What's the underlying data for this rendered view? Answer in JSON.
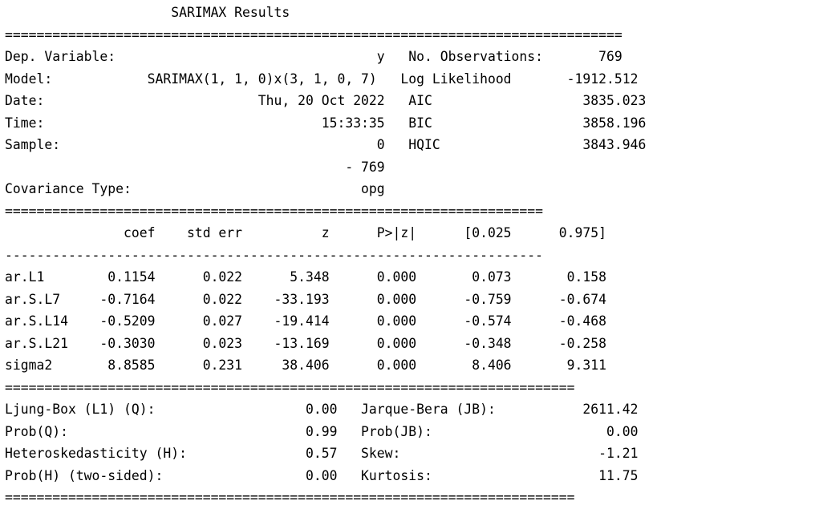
{
  "title": "SARIMAX Results",
  "lines": [
    "                     SARIMAX Results                                          ",
    "==============================================================================",
    "Dep. Variable:                                 y   No. Observations:       769",
    "Model:            SARIMAX(1, 1, 0)x(3, 1, 0, 7)   Log Likelihood       -1912.512",
    "Date:                           Thu, 20 Oct 2022   AIC                   3835.023",
    "Time:                                   15:33:35   BIC                   3858.196",
    "Sample:                                        0   HQIC                  3843.946",
    "                                           - 769                                ",
    "Covariance Type:                             opg                                ",
    "====================================================================",
    "               coef    std err          z      P>|z|      [0.025      0.975]",
    "--------------------------------------------------------------------",
    "ar.L1        0.1154      0.022      5.348      0.000       0.073       0.158",
    "ar.S.L7     -0.7164      0.022    -33.193      0.000      -0.759      -0.674",
    "ar.S.L14    -0.5209      0.027    -19.414      0.000      -0.574      -0.468",
    "ar.S.L21    -0.3030      0.023    -13.169      0.000      -0.348      -0.258",
    "sigma2       8.8585      0.231     38.406      0.000       8.406       9.311",
    "========================================================================",
    "Ljung-Box (L1) (Q):                   0.00   Jarque-Bera (JB):           2611.42",
    "Prob(Q):                              0.99   Prob(JB):                      0.00",
    "Heteroskedasticity (H):               0.57   Skew:                         -1.21",
    "Prob(H) (two-sided):                  0.00   Kurtosis:                     11.75",
    "========================================================================"
  ]
}
